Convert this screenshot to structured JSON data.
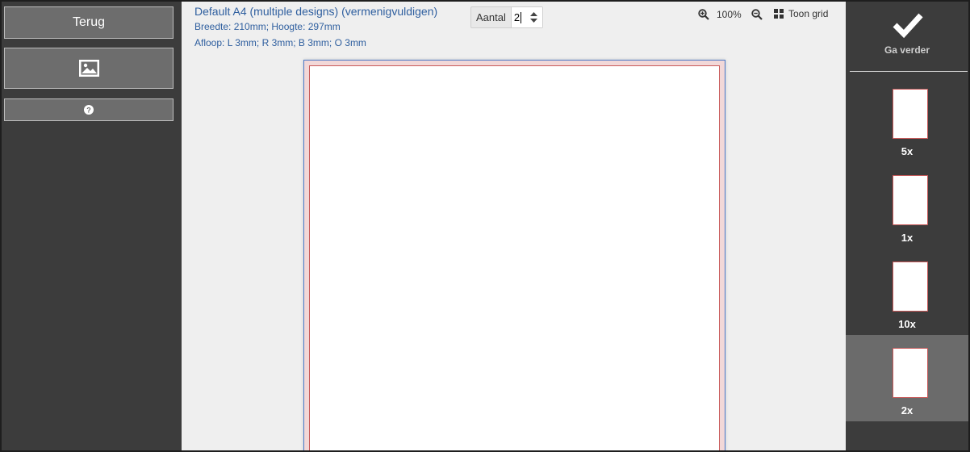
{
  "left": {
    "back_label": "Terug",
    "image_icon": "image-icon",
    "help_icon": "help-icon"
  },
  "doc": {
    "title": "Default A4 (multiple designs) (vermenigvuldigen)",
    "dimensions": "Breedte: 210mm; Hoogte: 297mm",
    "bleed": "Afloop: L 3mm; R 3mm; B 3mm; O 3mm"
  },
  "toolbar": {
    "quantity_label": "Aantal",
    "quantity_value": "2",
    "zoom_in_icon": "zoom-in-icon",
    "zoom_level": "100%",
    "zoom_out_icon": "zoom-out-icon",
    "grid_icon": "grid-icon",
    "grid_label": "Toon grid"
  },
  "right": {
    "continue_label": "Ga verder",
    "options": [
      {
        "label": "5x",
        "active": false
      },
      {
        "label": "1x",
        "active": false
      },
      {
        "label": "10x",
        "active": false
      },
      {
        "label": "2x",
        "active": true
      }
    ]
  },
  "colors": {
    "accent_text": "#2f5f9f",
    "sidebar_bg": "#3c3c3c",
    "canvas_bg": "#efefef",
    "trim_line": "#c85a5a",
    "sheet_border": "#4a78c8"
  }
}
